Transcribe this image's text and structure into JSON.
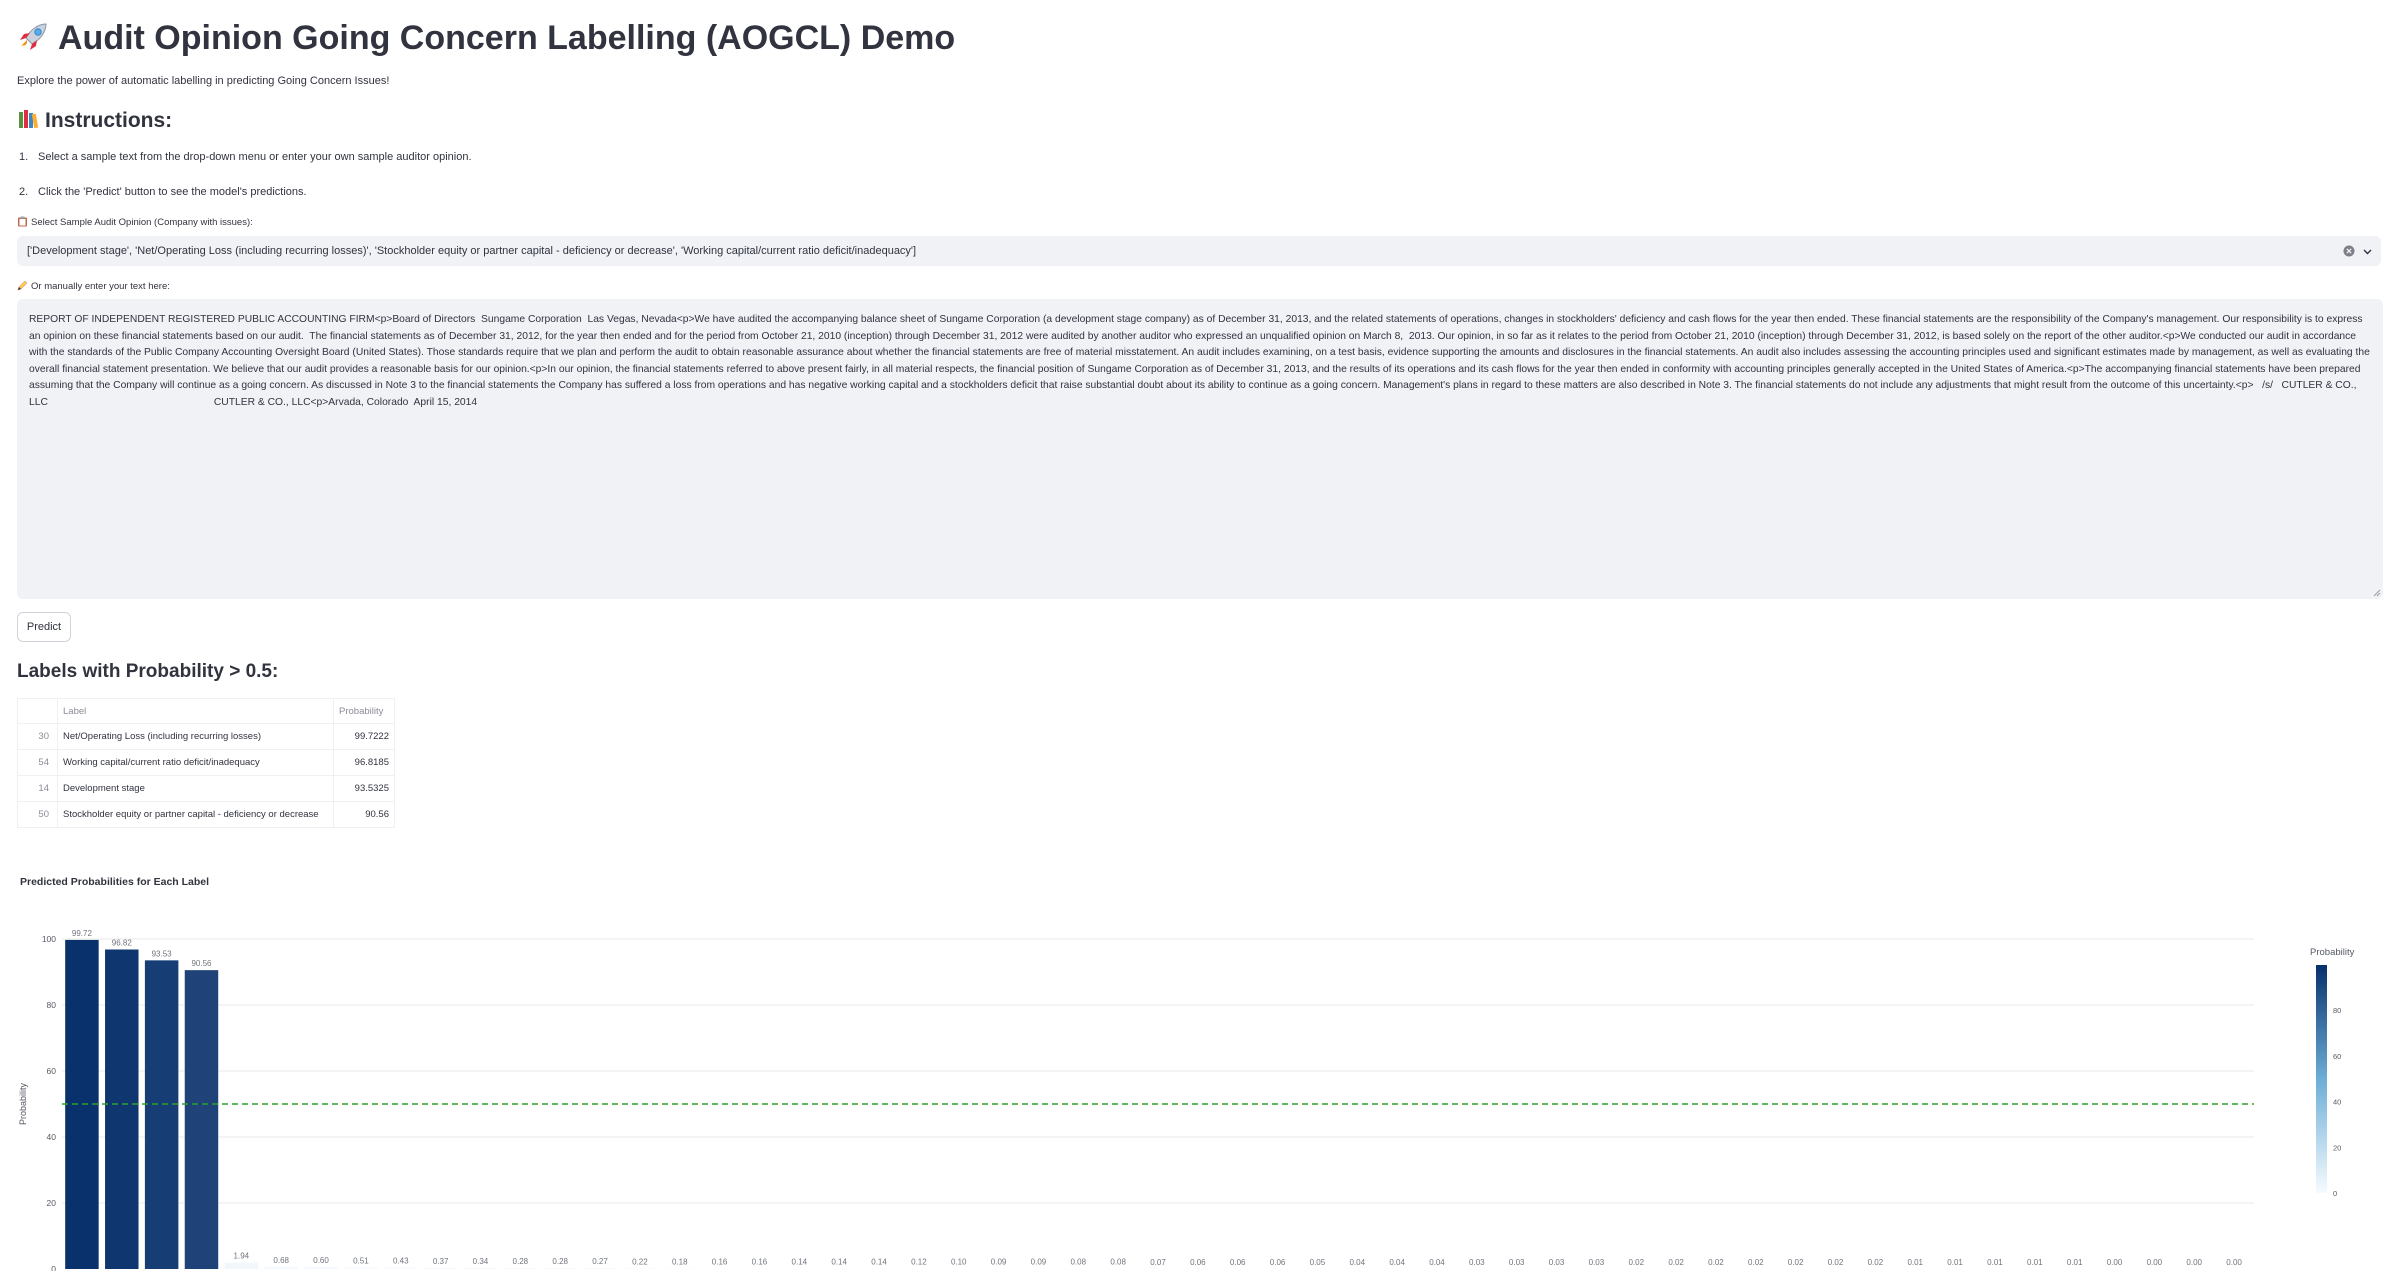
{
  "header": {
    "title": "Audit Opinion Going Concern Labelling (AOGCL) Demo",
    "subtitle": "Explore the power of automatic labelling in predicting Going Concern Issues!",
    "instructions_heading": "Instructions:"
  },
  "instructions": [
    {
      "num": "1.",
      "text": "Select a sample text from the drop-down menu or enter your own sample auditor opinion."
    },
    {
      "num": "2.",
      "text": "Click the 'Predict' button to see the model's predictions."
    }
  ],
  "select": {
    "label": "Select Sample Audit Opinion (Company with issues):",
    "value": "['Development stage', 'Net/Operating Loss (including recurring losses)', 'Stockholder equity or partner capital - deficiency or decrease', 'Working capital/current ratio deficit/inadequacy']"
  },
  "manual": {
    "label": "Or manually enter your text here:",
    "value": "REPORT OF INDEPENDENT REGISTERED PUBLIC ACCOUNTING FIRM<p>Board of Directors  Sungame Corporation  Las Vegas, Nevada<p>We have audited the accompanying balance sheet of Sungame Corporation (a development stage company) as of December 31, 2013, and the related statements of operations, changes in stockholders' deficiency and cash flows for the year then ended. These financial statements are the responsibility of the Company's management. Our responsibility is to express an opinion on these financial statements based on our audit.  The financial statements as of December 31, 2012, for the year then ended and for the period from October 21, 2010 (inception) through December 31, 2012 were audited by another auditor who expressed an unqualified opinion on March 8,  2013. Our opinion, in so far as it relates to the period from October 21, 2010 (inception) through December 31, 2012, is based solely on the report of the other auditor.<p>We conducted our audit in accordance with the standards of the Public Company Accounting Oversight Board (United States). Those standards require that we plan and perform the audit to obtain reasonable assurance about whether the financial statements are free of material misstatement. An audit includes examining, on a test basis, evidence supporting the amounts and disclosures in the financial statements. An audit also includes assessing the accounting principles used and significant estimates made by management, as well as evaluating the overall financial statement presentation. We believe that our audit provides a reasonable basis for our opinion.<p>In our opinion, the financial statements referred to above present fairly, in all material respects, the financial position of Sungame Corporation as of December 31, 2013, and the results of its operations and its cash flows for the year then ended in conformity with accounting principles generally accepted in the United States of America.<p>The accompanying financial statements have been prepared assuming that the Company will continue as a going concern. As discussed in Note 3 to the financial statements the Company has suffered a loss from operations and has negative working capital and a stockholders deficit that raise substantial doubt about its ability to continue as a going concern. Management's plans in regard to these matters are also described in Note 3. The financial statements do not include any adjustments that might result from the outcome of this uncertainty.<p>   /s/   CUTLER & CO., LLC                                                          CUTLER & CO., LLC<p>Arvada, Colorado  April 15, 2014"
  },
  "predict_button": "Predict",
  "results": {
    "heading": "Labels with Probability > 0.5:",
    "columns": [
      "",
      "Label",
      "Probability"
    ],
    "rows": [
      {
        "index": "30",
        "label": "Net/Operating Loss (including recurring losses)",
        "probability": "99.7222"
      },
      {
        "index": "54",
        "label": "Working capital/current ratio deficit/inadequacy",
        "probability": "96.8185"
      },
      {
        "index": "14",
        "label": "Development stage",
        "probability": "93.5325"
      },
      {
        "index": "50",
        "label": "Stockholder equity or partner capital - deficiency or decrease",
        "probability": "90.56"
      }
    ]
  },
  "chart_data": {
    "type": "bar",
    "title": "Predicted Probabilities for Each Label",
    "ylabel": "Probability",
    "xlabel": "",
    "ylim": [
      0,
      100
    ],
    "yticks": [
      0,
      20,
      40,
      60,
      80,
      100
    ],
    "threshold": 50,
    "values": [
      99.72,
      96.82,
      93.53,
      90.56,
      1.94,
      0.68,
      0.6,
      0.51,
      0.43,
      0.37,
      0.34,
      0.28,
      0.28,
      0.27,
      0.22,
      0.18,
      0.16,
      0.16,
      0.14,
      0.14,
      0.14,
      0.12,
      0.1,
      0.09,
      0.09,
      0.08,
      0.08,
      0.07,
      0.06,
      0.06,
      0.06,
      0.05,
      0.04,
      0.04,
      0.04,
      0.03,
      0.03,
      0.03,
      0.03,
      0.02,
      0.02,
      0.02,
      0.02,
      0.02,
      0.02,
      0.02,
      0.01,
      0.01,
      0.01,
      0.01,
      0.01,
      0.0,
      0.0,
      0.0,
      0.0
    ],
    "value_labels": [
      "99.72",
      "96.82",
      "93.53",
      "90.56",
      "1.94",
      "0.68",
      "0.60",
      "0.51",
      "0.43",
      "0.37",
      "0.34",
      "0.28",
      "0.28",
      "0.27",
      "0.22",
      "0.18",
      "0.16",
      "0.16",
      "0.14",
      "0.14",
      "0.14",
      "0.12",
      "0.10",
      "0.09",
      "0.09",
      "0.08",
      "0.08",
      "0.07",
      "0.06",
      "0.06",
      "0.06",
      "0.05",
      "0.04",
      "0.04",
      "0.04",
      "0.03",
      "0.03",
      "0.03",
      "0.03",
      "0.02",
      "0.02",
      "0.02",
      "0.02",
      "0.02",
      "0.02",
      "0.02",
      "0.01",
      "0.01",
      "0.01",
      "0.01",
      "0.01",
      "0.00",
      "0.00",
      "0.00",
      "0.00"
    ],
    "legend": {
      "title": "Probability",
      "ticks": [
        0,
        20,
        40,
        60,
        80
      ],
      "position": "right"
    },
    "colors": {
      "high": "#08306b",
      "low": "#f7fbff",
      "threshold_line": "#2ca02c",
      "grid": "#e8e8e8"
    }
  }
}
